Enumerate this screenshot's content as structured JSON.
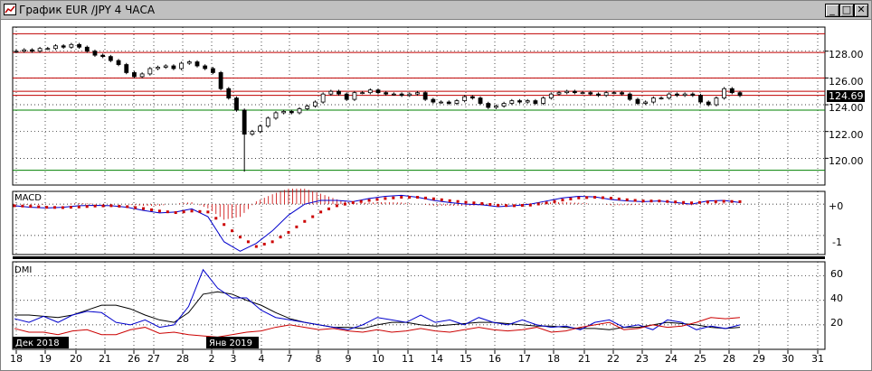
{
  "window": {
    "title": "График EUR /JPY  4 ЧАСА",
    "buttons": [
      "_",
      "□",
      "✕"
    ]
  },
  "colors": {
    "bull": "#000000",
    "bear": "#000000",
    "hline_red": "#c00000",
    "hline_green": "#008000",
    "macd_line": "#0000cc",
    "signal_dots": "#cc0000",
    "macd_hist": "#cc0000",
    "dmi_adx": "#000000",
    "dmi_plus": "#0000cc",
    "dmi_minus": "#cc0000",
    "grid": "#000000"
  },
  "main": {
    "price_labels": [
      "128.00",
      "126.00",
      "124.00",
      "122.00",
      "120.00"
    ],
    "current_price": "124.69",
    "hlines_red": [
      129.3,
      127.9,
      126.0,
      125.0,
      124.7
    ],
    "hlines_green": [
      123.6,
      119.1
    ]
  },
  "macd": {
    "title": "MACD",
    "scale_labels": [
      "+0",
      "-1"
    ]
  },
  "dmi": {
    "title": "DMI",
    "scale_labels": [
      "60",
      "40",
      "20"
    ]
  },
  "time_axis": {
    "labels": [
      "18",
      "19",
      "20",
      "21",
      "26",
      "27",
      "28",
      "2",
      "3",
      "4",
      "7",
      "8",
      "9",
      "10",
      "11",
      "14",
      "15",
      "16",
      "17",
      "18",
      "21",
      "22",
      "23",
      "24",
      "25",
      "28",
      "29",
      "30",
      "31"
    ],
    "month_labels": [
      "Дек 2018",
      "Янв 2019"
    ]
  },
  "chart_data": [
    {
      "type": "candlestick",
      "title": "",
      "xlabel": "",
      "ylabel": "",
      "ylim": [
        118.0,
        129.8
      ],
      "close": [
        128.0,
        128.1,
        128.0,
        128.2,
        128.2,
        128.4,
        128.3,
        128.5,
        128.3,
        128.0,
        127.7,
        127.6,
        127.3,
        127.0,
        126.4,
        126.1,
        126.3,
        126.7,
        126.8,
        126.9,
        126.7,
        127.1,
        127.2,
        126.9,
        126.7,
        126.4,
        125.2,
        124.5,
        123.6,
        121.8,
        122.0,
        122.4,
        123.0,
        123.4,
        123.5,
        123.4,
        123.7,
        123.9,
        124.2,
        124.8,
        125.0,
        124.8,
        124.4,
        124.9,
        124.9,
        125.1,
        124.9,
        124.8,
        124.8,
        124.7,
        124.8,
        124.9,
        124.4,
        124.2,
        124.2,
        124.1,
        124.3,
        124.6,
        124.5,
        124.1,
        123.8,
        123.9,
        124.1,
        124.3,
        124.2,
        124.3,
        124.1,
        124.5,
        124.8,
        124.9,
        125.0,
        124.9,
        124.9,
        124.8,
        124.7,
        124.9,
        124.9,
        124.8,
        124.4,
        124.1,
        124.2,
        124.5,
        124.5,
        124.8,
        124.7,
        124.8,
        124.7,
        124.2,
        124.0,
        124.5,
        125.2,
        124.9,
        124.69
      ],
      "hlines": [
        129.3,
        127.9,
        126.0,
        125.0,
        124.7,
        123.6,
        119.1
      ]
    },
    {
      "type": "line",
      "title": "MACD",
      "series": [
        {
          "values": [
            -0.05,
            -0.1,
            -0.12,
            -0.1,
            -0.05,
            -0.04,
            -0.05,
            -0.1,
            -0.2,
            -0.28,
            -0.25,
            -0.15,
            -0.4,
            -1.2,
            -1.5,
            -1.25,
            -0.85,
            -0.35,
            0.0,
            0.12,
            0.12,
            0.08,
            0.18,
            0.25,
            0.28,
            0.22,
            0.12,
            0.05,
            0.0,
            -0.02,
            -0.08,
            -0.05,
            0.0,
            0.1,
            0.2,
            0.25,
            0.23,
            0.15,
            0.1,
            0.08,
            0.1,
            0.05,
            0.0,
            0.1,
            0.12,
            0.05
          ]
        },
        {
          "values": [
            -0.05,
            -0.07,
            -0.1,
            -0.11,
            -0.09,
            -0.06,
            -0.05,
            -0.08,
            -0.14,
            -0.22,
            -0.27,
            -0.22,
            -0.25,
            -0.65,
            -1.05,
            -1.35,
            -1.2,
            -0.9,
            -0.55,
            -0.25,
            -0.05,
            0.05,
            0.12,
            0.18,
            0.22,
            0.22,
            0.17,
            0.11,
            0.06,
            0.02,
            -0.04,
            -0.05,
            -0.03,
            0.04,
            0.13,
            0.2,
            0.22,
            0.19,
            0.14,
            0.1,
            0.1,
            0.07,
            0.04,
            0.07,
            0.09,
            0.08
          ]
        }
      ],
      "ylim": [
        -1.55,
        0.35
      ]
    },
    {
      "type": "line",
      "title": "DMI",
      "series": [
        {
          "values": [
            28,
            28,
            27,
            26,
            28,
            32,
            36,
            36,
            33,
            28,
            24,
            22,
            30,
            45,
            47,
            45,
            40,
            36,
            30,
            25,
            22,
            20,
            18,
            18,
            17,
            20,
            22,
            22,
            20,
            19,
            20,
            21,
            22,
            22,
            21,
            20,
            19,
            19,
            18,
            17,
            17,
            16,
            18,
            18,
            20,
            22,
            21,
            20,
            18,
            17,
            18
          ]
        },
        {
          "values": [
            25,
            22,
            27,
            22,
            28,
            31,
            30,
            22,
            20,
            24,
            18,
            20,
            35,
            65,
            50,
            42,
            42,
            32,
            26,
            24,
            22,
            20,
            18,
            16,
            20,
            26,
            24,
            22,
            28,
            22,
            24,
            20,
            26,
            22,
            20,
            24,
            20,
            18,
            19,
            16,
            22,
            24,
            18,
            20,
            16,
            24,
            22,
            16,
            19,
            17,
            20
          ]
        },
        {
          "values": [
            17,
            14,
            14,
            12,
            15,
            16,
            12,
            12,
            16,
            18,
            13,
            14,
            12,
            11,
            10,
            12,
            14,
            15,
            18,
            20,
            18,
            16,
            17,
            15,
            14,
            16,
            14,
            15,
            17,
            15,
            14,
            16,
            18,
            16,
            15,
            16,
            18,
            14,
            15,
            18,
            20,
            22,
            16,
            17,
            20,
            18,
            19,
            22,
            26,
            25,
            26
          ]
        }
      ],
      "ylim": [
        0,
        70
      ]
    }
  ]
}
